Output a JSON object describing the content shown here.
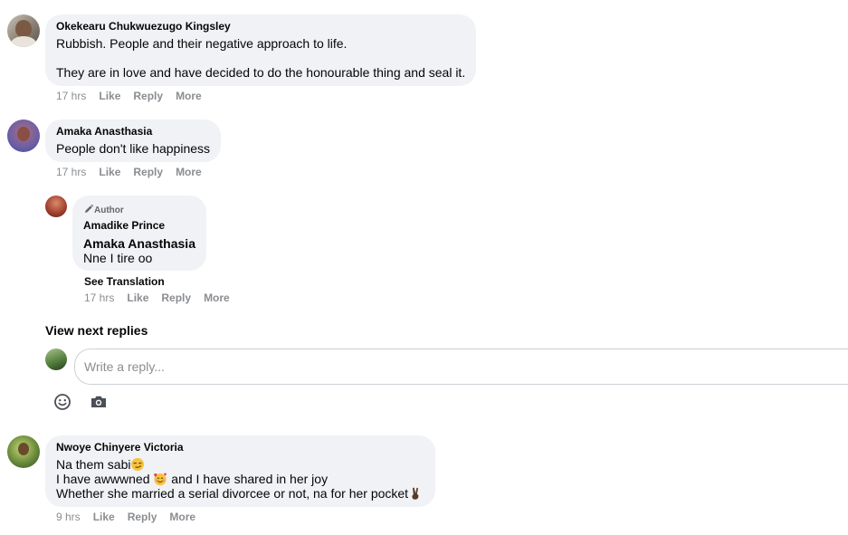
{
  "comments": [
    {
      "author": "Okekearu Chukwuezugo Kingsley",
      "lines": [
        "Rubbish. People and their negative approach to life.",
        "They are in love and have decided to do the honourable thing and seal it."
      ],
      "time": "17 hrs",
      "like": "Like",
      "reply": "Reply",
      "more": "More"
    },
    {
      "author": "Amaka Anasthasia",
      "lines": [
        "People don't like happiness"
      ],
      "time": "17 hrs",
      "like": "Like",
      "reply": "Reply",
      "more": "More"
    },
    {
      "author": "Nwoye Chinyere Victoria",
      "lines": [
        "Na them sabi",
        "I have awwwned ",
        " and I have shared in her joy",
        "Whether she married a serial divorcee or not, na for her pocket"
      ],
      "time": "9 hrs",
      "like": "Like",
      "reply": "Reply",
      "more": "More"
    }
  ],
  "reply": {
    "badge": "Author",
    "author": "Amadike Prince",
    "mention": "Amaka Anasthasia",
    "text": "Nne I tire oo",
    "see_translation": "See Translation",
    "time": "17 hrs",
    "like": "Like",
    "reply": "Reply",
    "more": "More"
  },
  "view_next_replies": "View next replies",
  "composer": {
    "placeholder": "Write a reply...",
    "icons": [
      "emoji-icon",
      "camera-icon"
    ]
  },
  "colors": {
    "bubble": "#f0f2f5",
    "meta": "#8a8d91",
    "text": "#050505"
  }
}
